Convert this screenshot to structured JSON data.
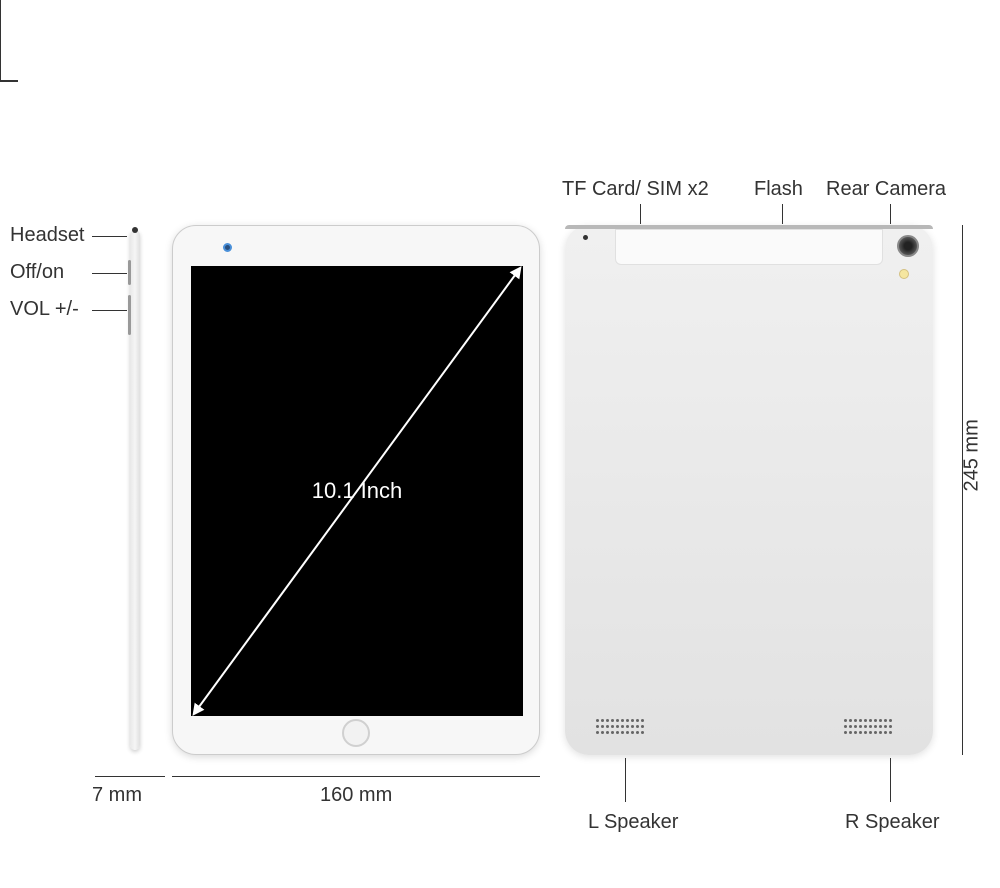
{
  "side_labels": {
    "headset": "Headset",
    "power": "Off/on",
    "volume": "VOL +/-"
  },
  "top_labels": {
    "tf_sim": "TF Card/ SIM x2",
    "flash": "Flash",
    "rear_camera": "Rear Camera"
  },
  "bottom_labels": {
    "left_speaker": "L Speaker",
    "right_speaker": "R Speaker"
  },
  "screen": {
    "diagonal": "10.1 Inch"
  },
  "dimensions": {
    "thickness": "7 mm",
    "width": "160 mm",
    "height": "245 mm"
  }
}
